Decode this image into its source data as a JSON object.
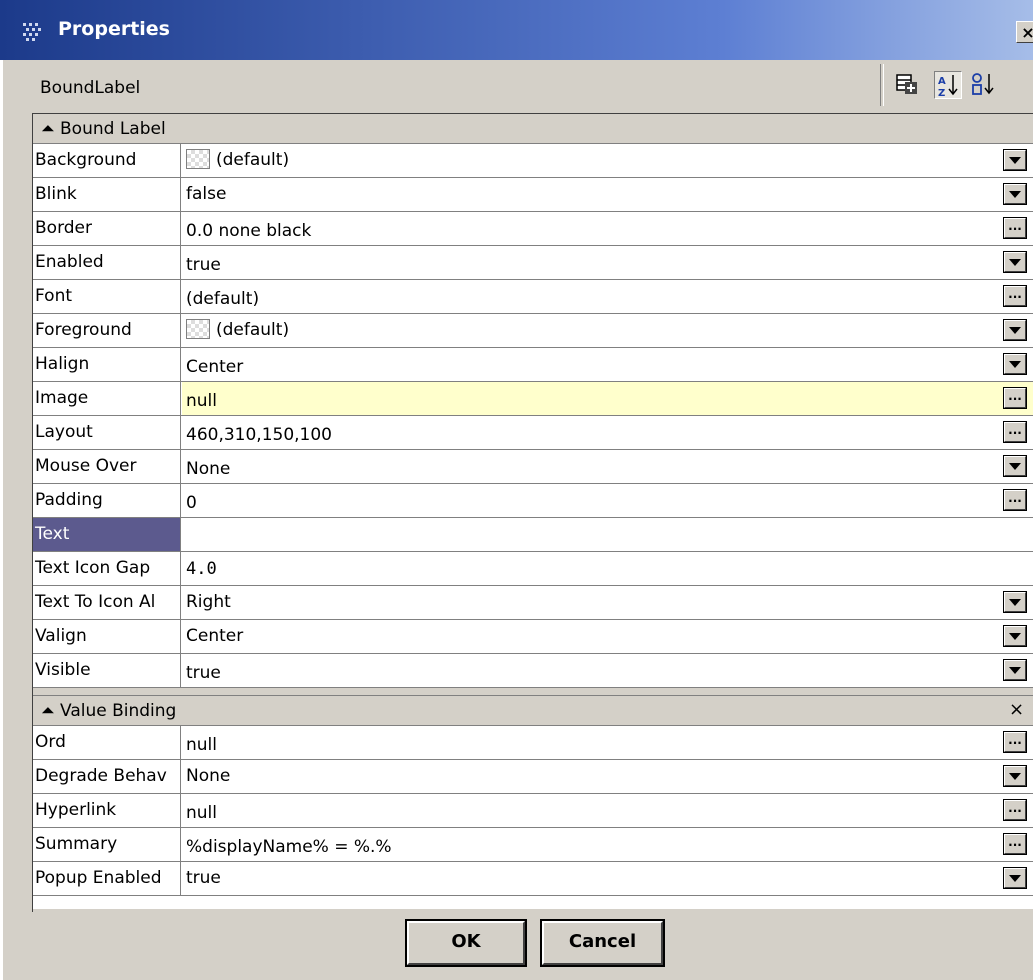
{
  "window": {
    "title": "Properties",
    "close_glyph": "×"
  },
  "header": {
    "object_name": "BoundLabel"
  },
  "toolbar": {
    "icons": [
      "add-slot-icon",
      "sort-alpha-icon",
      "sort-numeric-icon"
    ]
  },
  "groups": {
    "bound_label": {
      "title": "Bound Label",
      "rows": [
        {
          "name": "Background",
          "value": "(default)"
        },
        {
          "name": "Blink",
          "value": "false"
        },
        {
          "name": "Border",
          "value": "0.0 none black"
        },
        {
          "name": "Enabled",
          "value": "true"
        },
        {
          "name": "Font",
          "value": "(default)"
        },
        {
          "name": "Foreground",
          "value": "(default)"
        },
        {
          "name": "Halign",
          "value": "Center"
        },
        {
          "name": "Image",
          "value": "null"
        },
        {
          "name": "Layout",
          "value": "460,310,150,100"
        },
        {
          "name": "Mouse Over",
          "value": "None"
        },
        {
          "name": "Padding",
          "value": "0"
        },
        {
          "name": "Text",
          "value": ""
        },
        {
          "name": "Text Icon Gap",
          "value": "4.0"
        },
        {
          "name": "Text To Icon Al",
          "value": "Right"
        },
        {
          "name": "Valign",
          "value": "Center"
        },
        {
          "name": "Visible",
          "value": "true"
        }
      ]
    },
    "value_binding": {
      "title": "Value Binding",
      "close_glyph": "×",
      "rows": [
        {
          "name": "Ord",
          "value": "null"
        },
        {
          "name": "Degrade Behav",
          "value": "None"
        },
        {
          "name": "Hyperlink",
          "value": "null"
        },
        {
          "name": "Summary",
          "value": "%displayName% = %.%"
        },
        {
          "name": "Popup Enabled",
          "value": "true"
        }
      ]
    }
  },
  "buttons": {
    "ok": "OK",
    "cancel": "Cancel"
  },
  "colors": {
    "title_start": "#1c3a8a",
    "selected_row": "#5c5a8e",
    "highlight_row": "#ffffcc",
    "face": "#d4d0c8"
  }
}
